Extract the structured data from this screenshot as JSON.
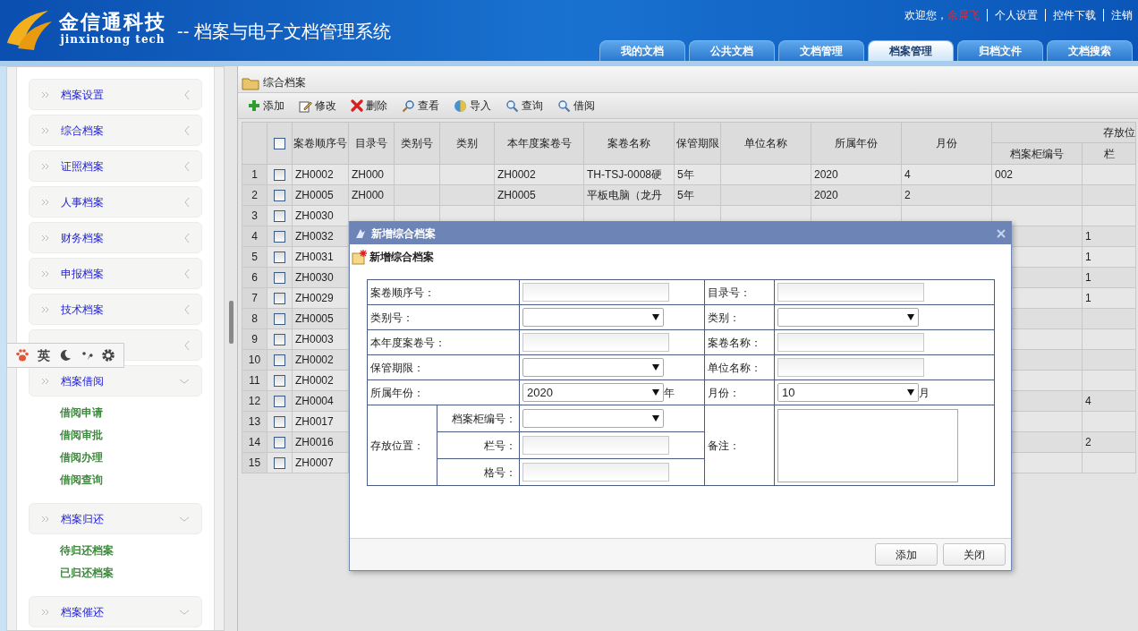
{
  "header": {
    "logo_text": "金信通科技",
    "logo_subtext": "jinxintong tech",
    "system_title": "-- 档案与电子文档管理系统",
    "welcome": "欢迎您，",
    "user": "余晨飞",
    "links": [
      "个人设置",
      "控件下载",
      "注销"
    ],
    "tabs": [
      {
        "label": "我的文档",
        "selected": false
      },
      {
        "label": "公共文档",
        "selected": false
      },
      {
        "label": "文档管理",
        "selected": false
      },
      {
        "label": "档案管理",
        "selected": true
      },
      {
        "label": "归档文件",
        "selected": false
      },
      {
        "label": "文档搜索",
        "selected": false
      }
    ]
  },
  "sidebar": {
    "items": [
      {
        "label": "档案设置",
        "expanded": false
      },
      {
        "label": "综合档案",
        "expanded": false
      },
      {
        "label": "证照档案",
        "expanded": false
      },
      {
        "label": "人事档案",
        "expanded": false
      },
      {
        "label": "财务档案",
        "expanded": false
      },
      {
        "label": "申报档案",
        "expanded": false
      },
      {
        "label": "技术档案",
        "expanded": false
      },
      {
        "expanded": false
      },
      {
        "label": "档案借阅",
        "expanded": true,
        "children": [
          "借阅申请",
          "借阅审批",
          "借阅办理",
          "借阅查询"
        ]
      },
      {
        "label": "档案归还",
        "expanded": true,
        "children": [
          "待归还档案",
          "已归还档案"
        ]
      },
      {
        "label": "档案催还",
        "expanded": true
      }
    ]
  },
  "ime_toolbar": {
    "label": "英"
  },
  "panel": {
    "title": "综合档案",
    "toolbar": [
      "添加",
      "修改",
      "删除",
      "查看",
      "导入",
      "查询",
      "借阅"
    ],
    "table": {
      "select_all_checked": false,
      "columns": [
        "案卷顺序号",
        "目录号",
        "类别号",
        "类别",
        "本年度案卷号",
        "案卷名称",
        "保管期限",
        "单位名称",
        "所属年份",
        "月份"
      ],
      "group_header": "存放位",
      "sub_columns": [
        "档案柜编号",
        "栏"
      ],
      "rows": [
        {
          "index": "1",
          "checked": false,
          "cells": [
            "ZH0002",
            "ZH000",
            "",
            "",
            "ZH0002",
            "TH-TSJ-0008硬",
            "5年",
            "",
            "2020",
            "4",
            "002",
            ""
          ]
        },
        {
          "index": "2",
          "checked": false,
          "cells": [
            "ZH0005",
            "ZH000",
            "",
            "",
            "ZH0005",
            "平板电脑（龙丹",
            "5年",
            "",
            "2020",
            "2",
            "",
            ""
          ]
        },
        {
          "index": "3",
          "checked": false,
          "cells": [
            "ZH0030",
            "",
            "",
            "",
            "",
            "",
            "",
            "",
            "",
            "",
            "",
            ""
          ]
        },
        {
          "index": "4",
          "checked": false,
          "cells": [
            "ZH0032",
            "",
            "",
            "",
            "",
            "",
            "",
            "",
            "",
            "",
            "",
            "1"
          ]
        },
        {
          "index": "5",
          "checked": false,
          "cells": [
            "ZH0031",
            "",
            "",
            "",
            "",
            "",
            "",
            "",
            "",
            "",
            "",
            "1"
          ]
        },
        {
          "index": "6",
          "checked": false,
          "cells": [
            "ZH0030",
            "",
            "",
            "",
            "",
            "",
            "",
            "",
            "",
            "",
            "",
            "1"
          ]
        },
        {
          "index": "7",
          "checked": false,
          "cells": [
            "ZH0029",
            "",
            "",
            "",
            "",
            "",
            "",
            "",
            "",
            "",
            "",
            "1"
          ]
        },
        {
          "index": "8",
          "checked": false,
          "cells": [
            "ZH0005",
            "",
            "",
            "",
            "",
            "",
            "",
            "",
            "",
            "",
            "",
            ""
          ]
        },
        {
          "index": "9",
          "checked": false,
          "cells": [
            "ZH0003",
            "",
            "",
            "",
            "",
            "",
            "",
            "",
            "",
            "",
            "",
            ""
          ]
        },
        {
          "index": "10",
          "checked": false,
          "cells": [
            "ZH0002",
            "",
            "",
            "",
            "",
            "",
            "",
            "",
            "",
            "",
            "",
            ""
          ]
        },
        {
          "index": "11",
          "checked": false,
          "cells": [
            "ZH0002",
            "",
            "",
            "",
            "",
            "",
            "",
            "",
            "",
            "",
            "",
            ""
          ]
        },
        {
          "index": "12",
          "checked": false,
          "cells": [
            "ZH0004",
            "",
            "",
            "",
            "",
            "",
            "",
            "",
            "",
            "",
            "",
            "4"
          ]
        },
        {
          "index": "13",
          "checked": false,
          "cells": [
            "ZH0017",
            "",
            "",
            "",
            "",
            "",
            "",
            "",
            "",
            "",
            "",
            ""
          ]
        },
        {
          "index": "14",
          "checked": false,
          "cells": [
            "ZH0016",
            "",
            "",
            "",
            "",
            "",
            "",
            "",
            "",
            "",
            "",
            "2"
          ]
        },
        {
          "index": "15",
          "checked": false,
          "cells": [
            "ZH0007",
            "",
            "",
            "",
            "",
            "",
            "",
            "",
            "",
            "",
            "",
            ""
          ]
        }
      ]
    }
  },
  "dialog": {
    "title": "新增综合档案",
    "heading": "新增综合档案",
    "rows": [
      [
        {
          "label": "案卷顺序号：",
          "kind": "text"
        },
        {
          "label": "目录号：",
          "kind": "text"
        }
      ],
      [
        {
          "label": "类别号：",
          "kind": "select"
        },
        {
          "label": "类别：",
          "kind": "select"
        }
      ],
      [
        {
          "label": "本年度案卷号：",
          "kind": "text"
        },
        {
          "label": "案卷名称：",
          "kind": "text"
        }
      ],
      [
        {
          "label": "保管期限：",
          "kind": "select"
        },
        {
          "label": "单位名称：",
          "kind": "text"
        }
      ],
      [
        {
          "label": "所属年份：",
          "kind": "select",
          "value": "2020",
          "suffix": "年"
        },
        {
          "label": "月份：",
          "kind": "select",
          "value": "10",
          "suffix": "月"
        }
      ]
    ],
    "storage": {
      "label": "存放位置：",
      "fields": [
        {
          "label": "档案柜编号：",
          "kind": "select"
        },
        {
          "label": "栏号：",
          "kind": "text"
        },
        {
          "label": "格号：",
          "kind": "text"
        }
      ]
    },
    "notes": {
      "label": "备注：",
      "kind": "textarea"
    },
    "buttons": [
      "添加",
      "关闭"
    ]
  }
}
